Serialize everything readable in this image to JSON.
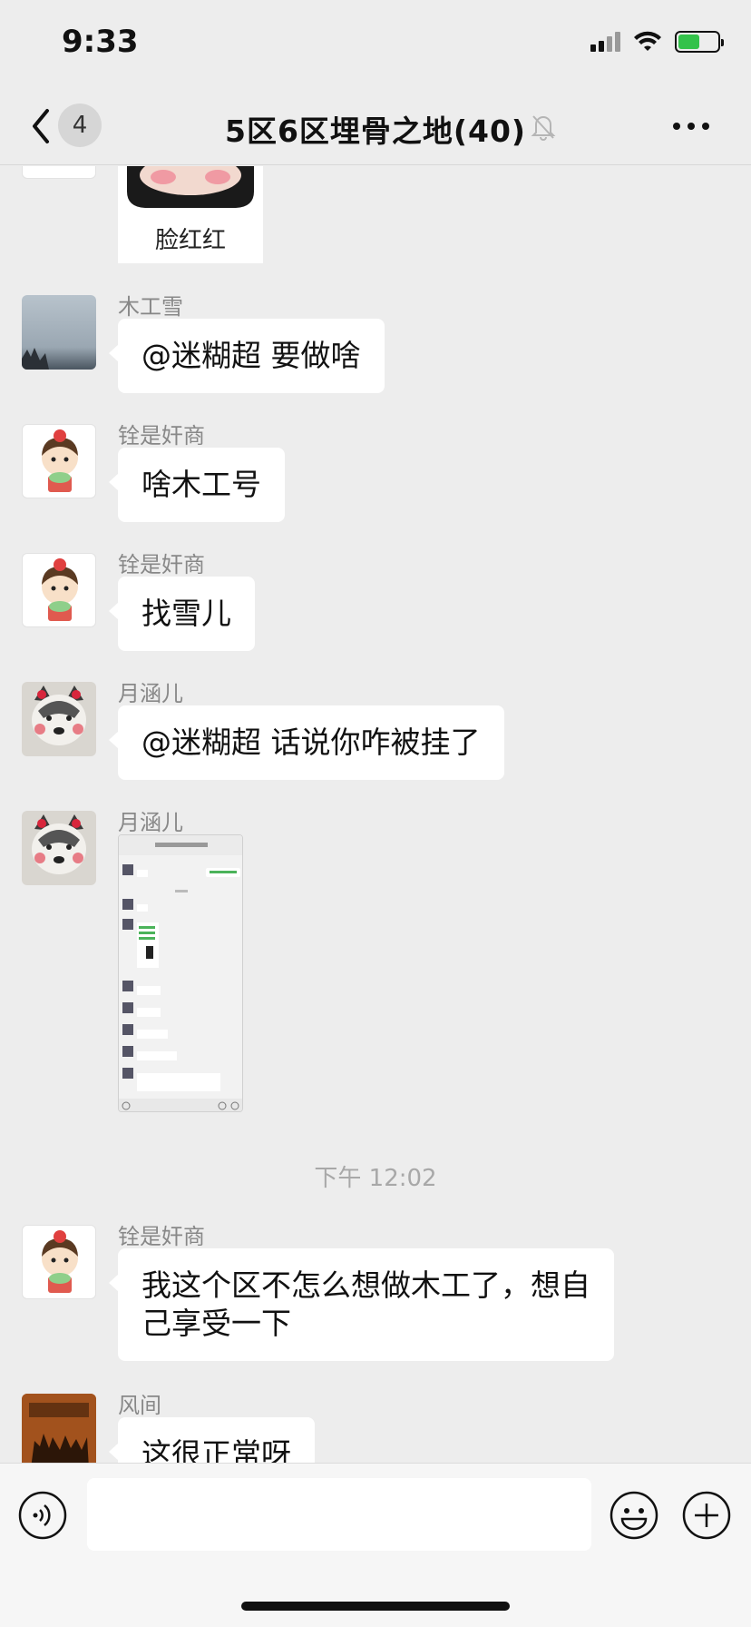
{
  "status_bar": {
    "time": "9:33"
  },
  "nav": {
    "unread_count": "4",
    "title": "5区6区埋骨之地(40)"
  },
  "messages": [
    {
      "type": "image",
      "sticker_caption": "脸红红"
    },
    {
      "type": "text",
      "sender": "木工雪",
      "text": "@迷糊超 要做啥"
    },
    {
      "type": "text",
      "sender": "铨是奸商",
      "text": "啥木工号"
    },
    {
      "type": "text",
      "sender": "铨是奸商",
      "text": "找雪儿"
    },
    {
      "type": "text",
      "sender": "月涵儿",
      "text": "@迷糊超 话说你咋被挂了"
    },
    {
      "type": "image",
      "sender": "月涵儿"
    },
    {
      "type": "time",
      "text": "下午 12:02"
    },
    {
      "type": "text",
      "sender": "铨是奸商",
      "text_line1": "我这个区不怎么想做木工了，想自",
      "text_line2": "己享受一下"
    },
    {
      "type": "text",
      "sender": "风间",
      "text": "这很正常呀"
    }
  ],
  "input": {
    "value": "",
    "placeholder": ""
  },
  "icons": {
    "back": "chevron-left-icon",
    "mute": "bell-off-icon",
    "more": "more-dots-icon",
    "voice": "voice-icon",
    "emoji": "emoji-icon",
    "plus": "plus-icon"
  },
  "colors": {
    "background": "#ededed",
    "bubble": "#ffffff",
    "sender": "#888888",
    "battery": "#33c24a"
  }
}
